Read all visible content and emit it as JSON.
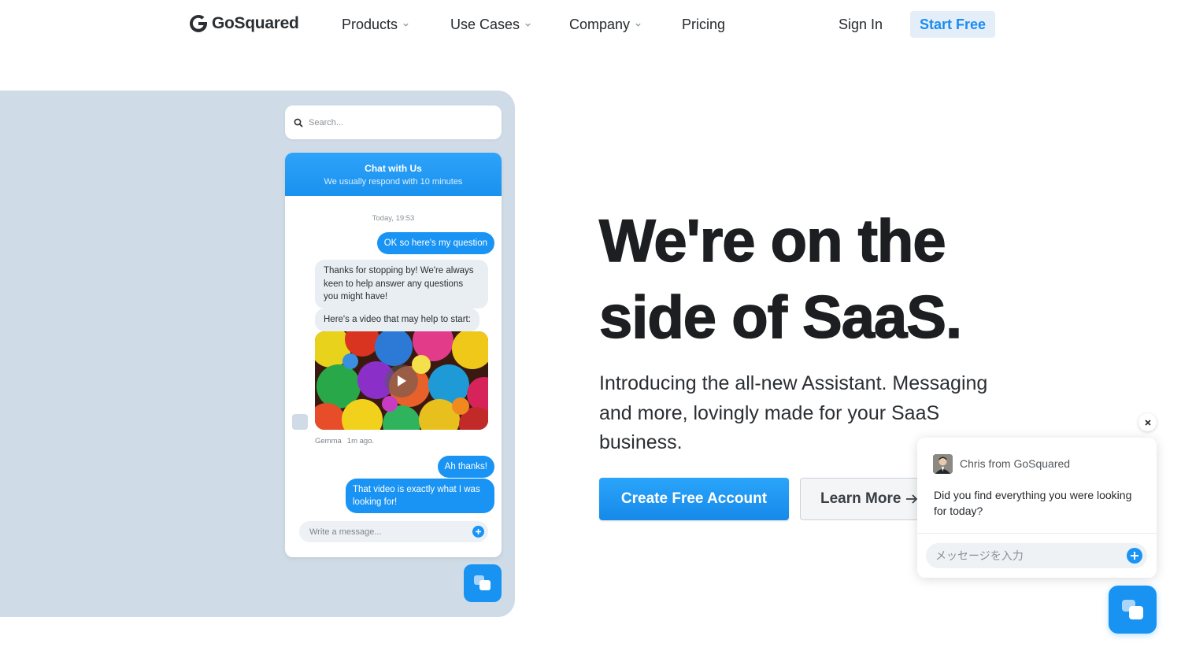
{
  "brand": {
    "name": "GoSquared",
    "accent": "#1a94f4",
    "panel_bg": "#cfdbe6"
  },
  "nav": {
    "items": [
      {
        "label": "Products",
        "has_dropdown": true
      },
      {
        "label": "Use Cases",
        "has_dropdown": true
      },
      {
        "label": "Company",
        "has_dropdown": true
      },
      {
        "label": "Pricing",
        "has_dropdown": false
      }
    ],
    "sign_in": "Sign In",
    "start_free": "Start Free"
  },
  "demo": {
    "search_placeholder": "Search...",
    "chat_title": "Chat with Us",
    "chat_subtitle": "We usually respond with 10 minutes",
    "timestamp": "Today, 19:53",
    "messages": [
      {
        "from": "visitor",
        "text": "OK so here's my question"
      },
      {
        "from": "agent",
        "text": "Thanks for stopping by! We're always keen to help answer any questions you might have!"
      },
      {
        "from": "agent",
        "text": "Here's a video that may help to start:"
      },
      {
        "from": "visitor",
        "text": "Ah thanks!"
      },
      {
        "from": "visitor",
        "text": "That video is exactly what I was looking for!"
      }
    ],
    "agent_name": "Gemma",
    "agent_time": "1m ago.",
    "composer_placeholder": "Write a message..."
  },
  "hero": {
    "title_line1": "We're on the",
    "title_line2": "side of SaaS.",
    "subtitle": "Introducing the all-new Assistant. Messaging and more, lovingly made for your SaaS business.",
    "cta_primary": "Create Free Account",
    "cta_secondary": "Learn More"
  },
  "popup": {
    "sender": "Chris from GoSquared",
    "message": "Did you find everything you were looking for today?",
    "input_placeholder": "メッセージを入力"
  }
}
